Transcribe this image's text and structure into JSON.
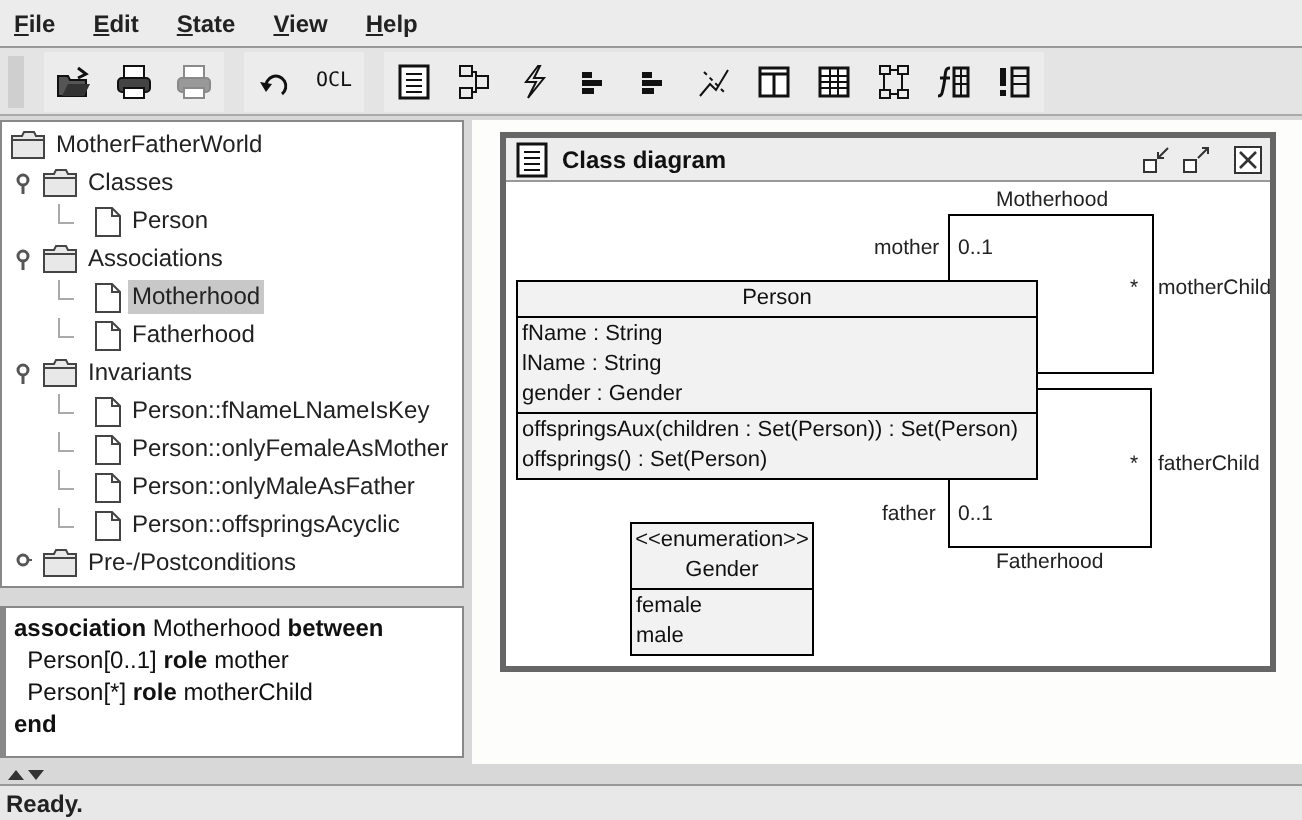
{
  "menu": [
    {
      "label": "File"
    },
    {
      "label": "Edit"
    },
    {
      "label": "State"
    },
    {
      "label": "View"
    },
    {
      "label": "Help"
    }
  ],
  "toolbar": [
    [
      {
        "disabled": false
      },
      {
        "disabled": false
      },
      {
        "disabled": true
      }
    ],
    [
      {
        "disabled": false
      },
      {
        "disabled": false,
        "label": "OCL"
      }
    ],
    [
      {
        "disabled": false
      },
      {
        "disabled": false
      },
      {
        "disabled": false
      },
      {
        "disabled": false
      },
      {
        "disabled": false
      },
      {
        "disabled": false
      },
      {
        "disabled": false
      },
      {
        "disabled": false
      },
      {
        "disabled": false
      },
      {
        "disabled": false
      },
      {
        "disabled": false
      }
    ]
  ],
  "tree": {
    "label": "MotherFatherWorld",
    "kind": "folder",
    "selected": false,
    "children": [
      {
        "label": "Classes",
        "kind": "folder",
        "expanded": true,
        "selected": false,
        "children": [
          {
            "label": "Person",
            "kind": "leaf",
            "selected": false
          }
        ]
      },
      {
        "label": "Associations",
        "kind": "folder",
        "expanded": true,
        "selected": false,
        "children": [
          {
            "label": "Motherhood",
            "kind": "leaf",
            "selected": true
          },
          {
            "label": "Fatherhood",
            "kind": "leaf",
            "selected": false
          }
        ]
      },
      {
        "label": "Invariants",
        "kind": "folder",
        "expanded": true,
        "selected": false,
        "children": [
          {
            "label": "Person::fNameLNameIsKey",
            "kind": "leaf",
            "selected": false
          },
          {
            "label": "Person::onlyFemaleAsMother",
            "kind": "leaf",
            "selected": false
          },
          {
            "label": "Person::onlyMaleAsFather",
            "kind": "leaf",
            "selected": false
          },
          {
            "label": "Person::offspringsAcyclic",
            "kind": "leaf",
            "selected": false
          }
        ]
      },
      {
        "label": "Pre-/Postconditions",
        "kind": "folder",
        "expanded": false,
        "selected": false
      }
    ]
  },
  "source": [
    "**association** Motherhood **between**",
    "  Person[0..1] **role** mother",
    "  Person[*] **role** motherChild",
    "**end**"
  ],
  "diagram": {
    "title": "Class diagram",
    "classes": [
      {
        "kind": "class",
        "name": "Person",
        "attributes": [
          "fName : String",
          "lName : String",
          "gender : Gender"
        ],
        "operations": [
          "offspringsAux(children : Set(Person)) : Set(Person)",
          "offsprings() : Set(Person)"
        ]
      },
      {
        "kind": "enumeration",
        "stereotype": "<<enumeration>>",
        "name": "Gender",
        "attributes": [
          "female",
          "male"
        ]
      }
    ],
    "associations": [
      {
        "name": "Motherhood",
        "role_1": "mother",
        "multiplicity_1": "0..1",
        "role_2": "motherChild",
        "multiplicity_2": "*"
      },
      {
        "name": "Fatherhood",
        "role_1": "father",
        "multiplicity_1": "0..1",
        "role_2": "fatherChild",
        "multiplicity_2": "*"
      }
    ]
  },
  "status_bar": "Ready."
}
